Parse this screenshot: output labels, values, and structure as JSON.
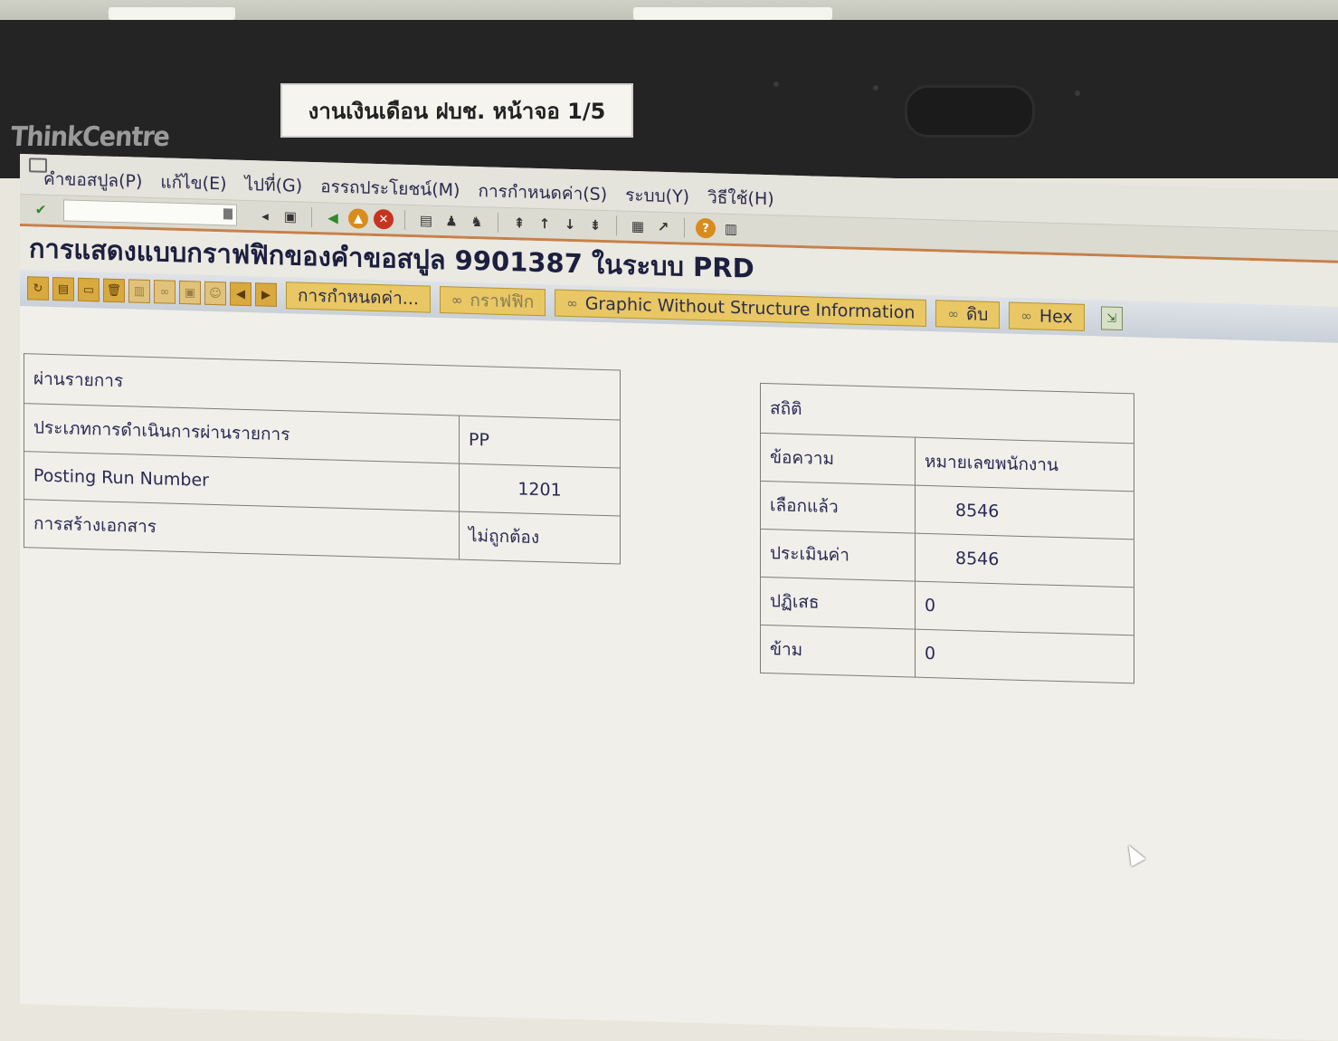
{
  "bezel": {
    "brand": "ThinkCentre",
    "sticker": "งานเงินเดือน ฝบช. หน้าจอ 1/5"
  },
  "menu": {
    "items": [
      "คำขอสปูล(P)",
      "แก้ไข(E)",
      "ไปที่(G)",
      "อรรถประโยชน์(M)",
      "การกำหนดค่า(S)",
      "ระบบ(Y)",
      "วิธีใช้(H)"
    ]
  },
  "toolbar": {
    "okcode_value": ""
  },
  "title": "การแสดงแบบกราฟฟิกของคำขอสปูล 9901387 ในระบบ PRD",
  "app_toolbar": {
    "settings_btn": "การกำหนดค่า...",
    "graphic_btn": "กราฟฟิก",
    "graphic_nostruct_btn": "Graphic Without Structure Information",
    "raw_btn": "ดิบ",
    "hex_btn": "Hex"
  },
  "posting": {
    "header": "ผ่านรายการ",
    "rows": [
      {
        "label": "ประเภทการดำเนินการผ่านรายการ",
        "value": "PP"
      },
      {
        "label": "Posting Run Number",
        "value": "1201"
      },
      {
        "label": "การสร้างเอกสาร",
        "value": "ไม่ถูกต้อง"
      }
    ]
  },
  "stats": {
    "header": "สถิติ",
    "rows": [
      {
        "label": "ข้อความ",
        "value": "หมายเลขพนักงาน"
      },
      {
        "label": "เลือกแล้ว",
        "value": "8546"
      },
      {
        "label": "ประเมินค่า",
        "value": "8546"
      },
      {
        "label": "ปฏิเสธ",
        "value": "0"
      },
      {
        "label": "ข้าม",
        "value": "0"
      }
    ]
  }
}
